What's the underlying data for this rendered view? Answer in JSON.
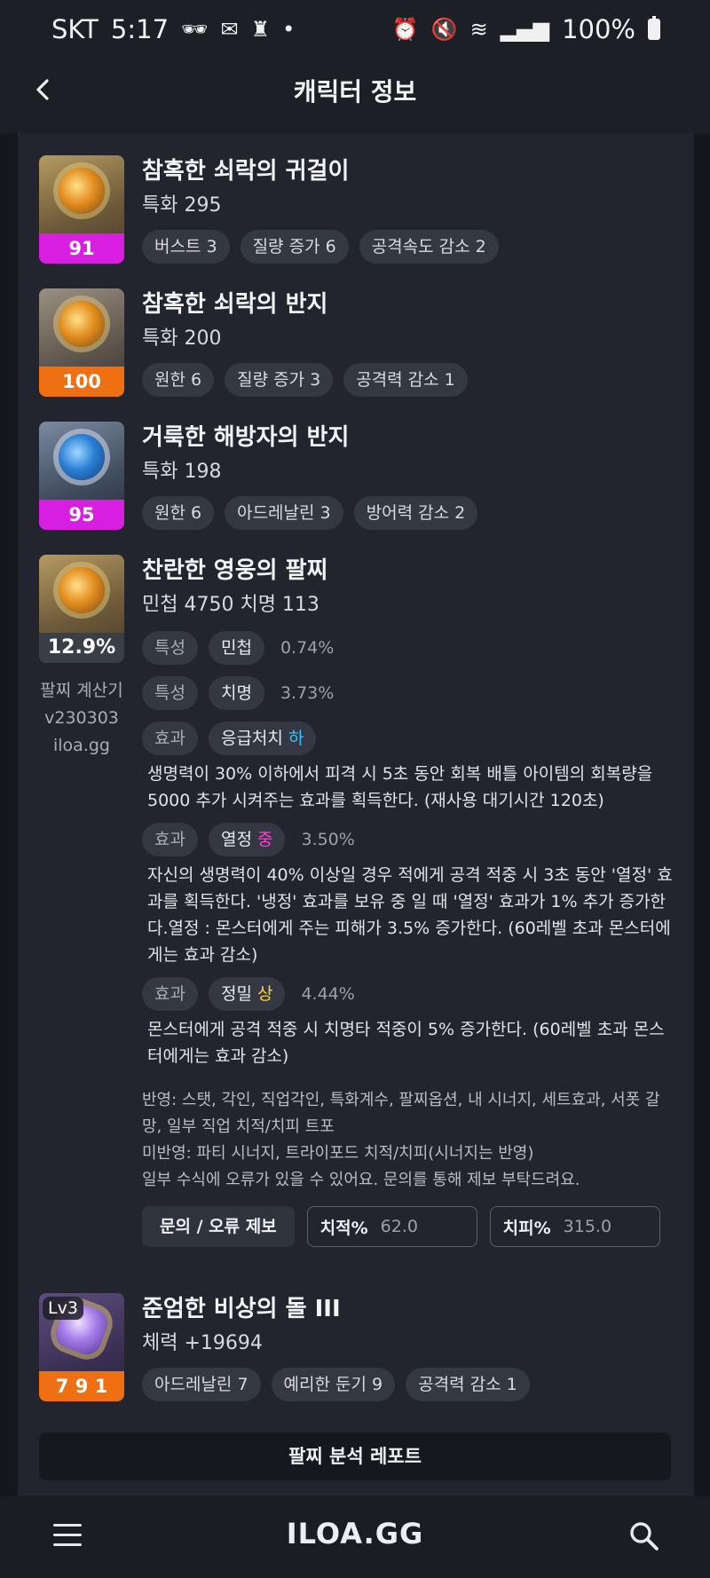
{
  "status": {
    "carrier": "SKT",
    "time": "5:17",
    "battery": "100%"
  },
  "header": {
    "title": "캐릭터 정보"
  },
  "items": [
    {
      "name": "참혹한 쇠락의 귀걸이",
      "stat": "특화 295",
      "quality": "91",
      "tags": [
        "버스트 3",
        "질량 증가 6",
        "공격속도 감소 2"
      ]
    },
    {
      "name": "참혹한 쇠락의 반지",
      "stat": "특화 200",
      "quality": "100",
      "tags": [
        "원한 6",
        "질량 증가 3",
        "공격력 감소 1"
      ]
    },
    {
      "name": "거룩한 해방자의 반지",
      "stat": "특화 198",
      "quality": "95",
      "tags": [
        "원한 6",
        "아드레날린 3",
        "방어력 감소 2"
      ]
    }
  ],
  "bracelet": {
    "name": "찬란한 영웅의 팔찌",
    "stat": "민첩 4750  치명 113",
    "percent": "12.9%",
    "calc_line1": "팔찌 계산기",
    "calc_line2": "v230303",
    "calc_line3": "iloa.gg",
    "rows": [
      {
        "kind": "특성",
        "label": "민첩",
        "value": "0.74%"
      },
      {
        "kind": "특성",
        "label": "치명",
        "value": "3.73%"
      }
    ],
    "effects": [
      {
        "kind": "효과",
        "label": "응급처치",
        "grade": "하",
        "value": "",
        "desc": "생명력이 30% 이하에서 피격 시 5초 동안 회복 배틀 아이템의 회복량을 5000 추가 시켜주는 효과를 획득한다. (재사용 대기시간 120초)"
      },
      {
        "kind": "효과",
        "label": "열정",
        "grade": "중",
        "value": "3.50%",
        "desc": "자신의 생명력이 40% 이상일 경우 적에게 공격 적중 시 3초 동안 '열정' 효과를 획득한다. '냉정' 효과를 보유 중 일 때 '열정' 효과가 1% 추가 증가한다.열정 : 몬스터에게 주는 피해가 3.5% 증가한다. (60레벨 초과 몬스터에게는 효과 감소)"
      },
      {
        "kind": "효과",
        "label": "정밀",
        "grade": "상",
        "value": "4.44%",
        "desc": "몬스터에게 공격 적중 시 치명타 적중이 5% 증가한다. (60레벨 초과 몬스터에게는 효과 감소)"
      }
    ],
    "notes": [
      "반영: 스탯, 각인, 직업각인, 특화계수, 팔찌옵션, 내 시너지, 세트효과, 서폿 갈망, 일부 직업 치적/치피 트포",
      "미반영: 파티 시너지, 트라이포드 치적/치피(시너지는 반영)",
      "일부 수식에 오류가 있을 수 있어요. 문의를 통해 제보 부탁드려요."
    ],
    "report_button": "문의 / 오류 제보",
    "crit_rate_label": "치적%",
    "crit_rate_value": "62.0",
    "crit_dmg_label": "치피%",
    "crit_dmg_value": "315.0"
  },
  "stone": {
    "level": "Lv3",
    "name": "준엄한 비상의 돌 III",
    "stat": "체력 +19694",
    "quality": "7 9 1",
    "tags": [
      "아드레날린 7",
      "예리한 둔기 9",
      "공격력 감소 1"
    ]
  },
  "analysis_button": "팔찌 분석 레포트",
  "bottom": {
    "brand": "ILOA.GG"
  },
  "colors": {
    "quality_pink": "#d81ee0",
    "quality_orange": "#ef6f13",
    "grade_low": "#3ec0ff",
    "grade_mid": "#ff3ed2",
    "grade_high": "#ffd43b"
  }
}
